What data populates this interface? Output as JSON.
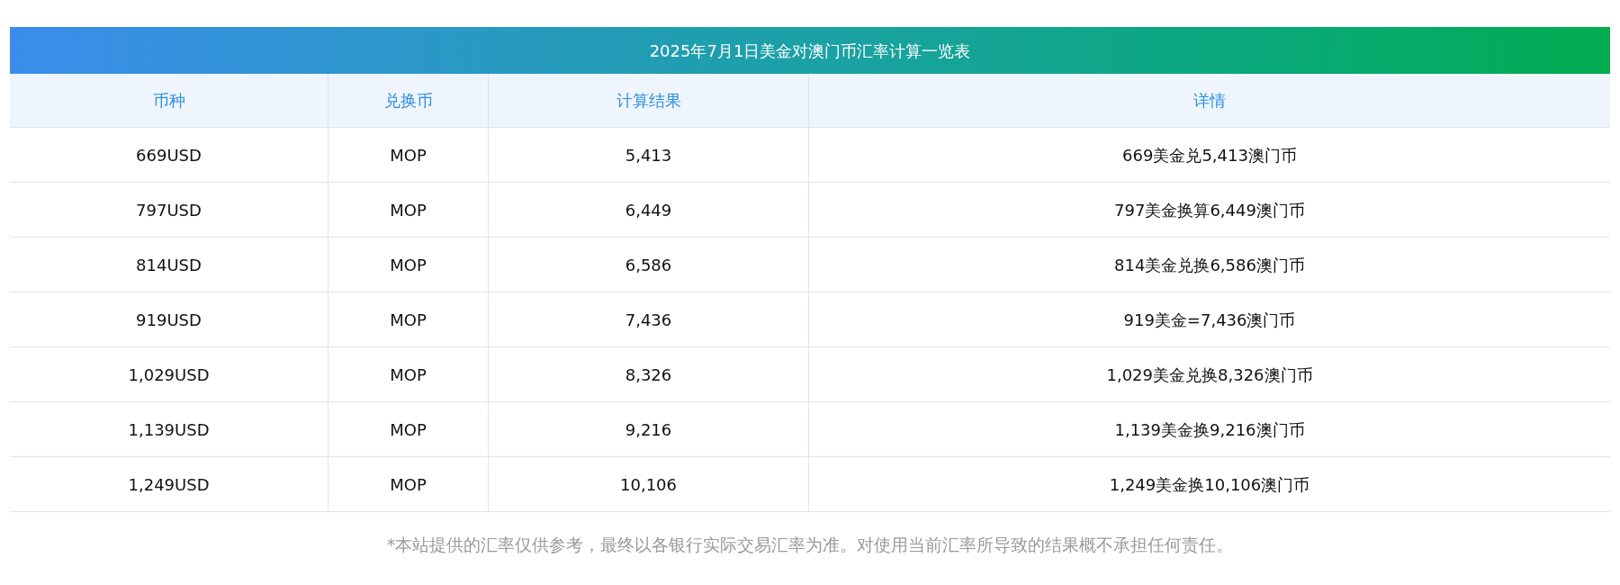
{
  "table": {
    "title": "2025年7月1日美金对澳门币汇率计算一览表",
    "columns": [
      "币种",
      "兑换币",
      "计算结果",
      "详情"
    ],
    "rows": [
      [
        "669USD",
        "MOP",
        "5,413",
        "669美金兑5,413澳门币"
      ],
      [
        "797USD",
        "MOP",
        "6,449",
        "797美金换算6,449澳门币"
      ],
      [
        "814USD",
        "MOP",
        "6,586",
        "814美金兑换6,586澳门币"
      ],
      [
        "919USD",
        "MOP",
        "7,436",
        "919美金=7,436澳门币"
      ],
      [
        "1,029USD",
        "MOP",
        "8,326",
        "1,029美金兑换8,326澳门币"
      ],
      [
        "1,139USD",
        "MOP",
        "9,216",
        "1,139美金换9,216澳门币"
      ],
      [
        "1,249USD",
        "MOP",
        "10,106",
        "1,249美金换10,106澳门币"
      ]
    ]
  },
  "footnote": "*本站提供的汇率仅供参考，最终以各银行实际交易汇率为准。对使用当前汇率所导致的结果概不承担任何责任。"
}
